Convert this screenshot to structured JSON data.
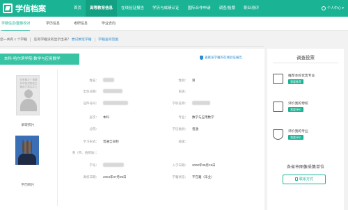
{
  "brand": {
    "name": "学信档案"
  },
  "nav": {
    "items": [
      "首页",
      "高等教育信息",
      "在线验证报告",
      "学历与成绩认证",
      "国际合作申请",
      "调查/投票",
      "职业测评"
    ],
    "user": "个人中心"
  },
  "subnav": {
    "tabs": [
      "学籍信息/图像校对",
      "学历信息",
      "考研信息",
      "毕业去向"
    ]
  },
  "breadcrumb": {
    "count_prefix": "您一共有",
    "count": "1",
    "count_suffix": "个学籍",
    "question": "还有学籍没有显示出来？",
    "link1": "尝试绑定学籍",
    "link2": "学籍查询范围"
  },
  "record": {
    "school": "本科-哈尔滨学院-数学与应用数学",
    "report_link": "查看该学籍的在线验证报告",
    "photo1_note": "没有照片？请联系学校或院校主管部门核实并上传",
    "photo1_caption": "录取照片",
    "photo2_caption": "学历照片",
    "fields": {
      "name": "姓名：",
      "gender": "性别：",
      "gender_val": "男",
      "birth": "出生日期：",
      "ethnicity": "民族：",
      "id": "证件号码：",
      "school_name": "学校名称：",
      "level": "层次：",
      "level_val": "本科",
      "major": "专业：",
      "major_val": "数学与应用数学",
      "dept": "分院：",
      "edu_form": "学历类别：",
      "edu_form_val": "普通",
      "study_form": "学习形式：",
      "study_form_val": "普通全日制",
      "class": "班级：",
      "branch": "系（所、函授站）：",
      "student_no": "学号：",
      "enroll": "入学日期：",
      "enroll_val": "2000年09月15日",
      "leave": "离校日期：",
      "leave_val": "2004年07月05日",
      "status": "学籍状态：",
      "status_val": "不在籍（毕业）"
    }
  },
  "sidebar": {
    "title": "调查投票",
    "items": [
      {
        "text": "推荐本校优势专业",
        "button": "我要推荐"
      },
      {
        "text": "评价我的母校",
        "button": "我要评价"
      },
      {
        "text": "评价我的专业",
        "button": "我要评价"
      }
    ],
    "footer": "各省市图像采集单位",
    "contact": "联系方式"
  }
}
